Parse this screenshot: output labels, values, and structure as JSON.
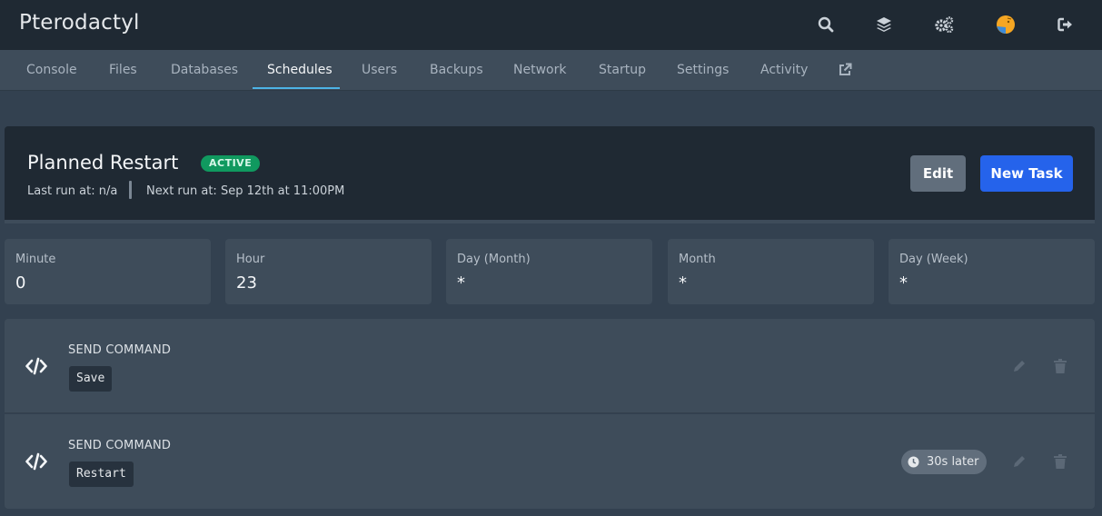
{
  "app": {
    "title": "Pterodactyl"
  },
  "top_icons": [
    "search-icon",
    "layers-icon",
    "cogs-icon",
    "avatar",
    "sign-out-icon"
  ],
  "tabs": [
    {
      "label": "Console"
    },
    {
      "label": "Files"
    },
    {
      "label": "Databases"
    },
    {
      "label": "Schedules",
      "active": true
    },
    {
      "label": "Users"
    },
    {
      "label": "Backups"
    },
    {
      "label": "Network"
    },
    {
      "label": "Startup"
    },
    {
      "label": "Settings"
    },
    {
      "label": "Activity"
    }
  ],
  "schedule": {
    "name": "Planned Restart",
    "status": "ACTIVE",
    "last_run_label": "Last run at:",
    "last_run_value": "n/a",
    "next_run_label": "Next run at:",
    "next_run_value": "Sep 12th at 11:00PM",
    "edit_label": "Edit",
    "new_task_label": "New Task"
  },
  "cron": [
    {
      "label": "Minute",
      "value": "0"
    },
    {
      "label": "Hour",
      "value": "23"
    },
    {
      "label": "Day (Month)",
      "value": "*"
    },
    {
      "label": "Month",
      "value": "*"
    },
    {
      "label": "Day (Week)",
      "value": "*"
    }
  ],
  "tasks": [
    {
      "title": "SEND COMMAND",
      "payload": "Save",
      "offset": ""
    },
    {
      "title": "SEND COMMAND",
      "payload": "Restart",
      "offset": "30s later"
    }
  ],
  "colors": {
    "topbar": "#1f2933",
    "subnav": "#3e4c5a",
    "background": "#334150",
    "active_badge": "#10995f",
    "primary_button": "#2563eb",
    "tab_underline": "#4db3e6"
  }
}
